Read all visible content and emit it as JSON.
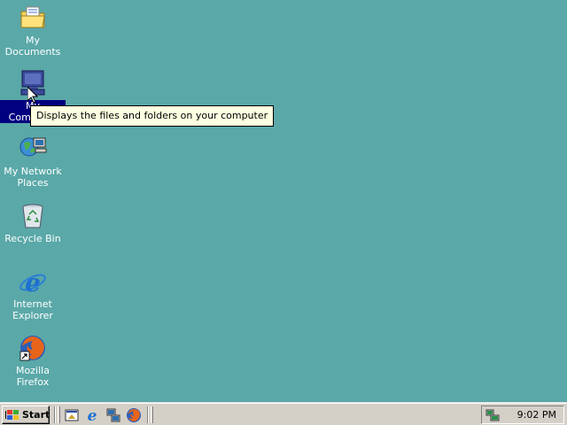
{
  "colors": {
    "desktop": "#5aa8a8",
    "taskbar": "#d4d0c8",
    "selection": "#000080",
    "tooltip_bg": "#ffffe1"
  },
  "desktop_icons": [
    {
      "label": "My Documents",
      "icon": "folder-documents-icon"
    },
    {
      "label": "My Computer",
      "icon": "computer-icon",
      "selected": true
    },
    {
      "label": "My Network Places",
      "icon": "network-places-icon"
    },
    {
      "label": "Recycle Bin",
      "icon": "recycle-bin-icon"
    },
    {
      "label": "Internet Explorer",
      "icon": "internet-explorer-icon"
    },
    {
      "label": "Mozilla Firefox",
      "icon": "firefox-icon",
      "shortcut": true
    }
  ],
  "tooltip": {
    "text": "Displays the files and folders on your computer"
  },
  "taskbar": {
    "start_label": "Start",
    "quick_launch": [
      "show-desktop-icon",
      "internet-explorer-icon",
      "network-icon",
      "firefox-icon"
    ],
    "tray": {
      "icon": "network-tray-icon",
      "clock": "9:02 PM"
    }
  }
}
